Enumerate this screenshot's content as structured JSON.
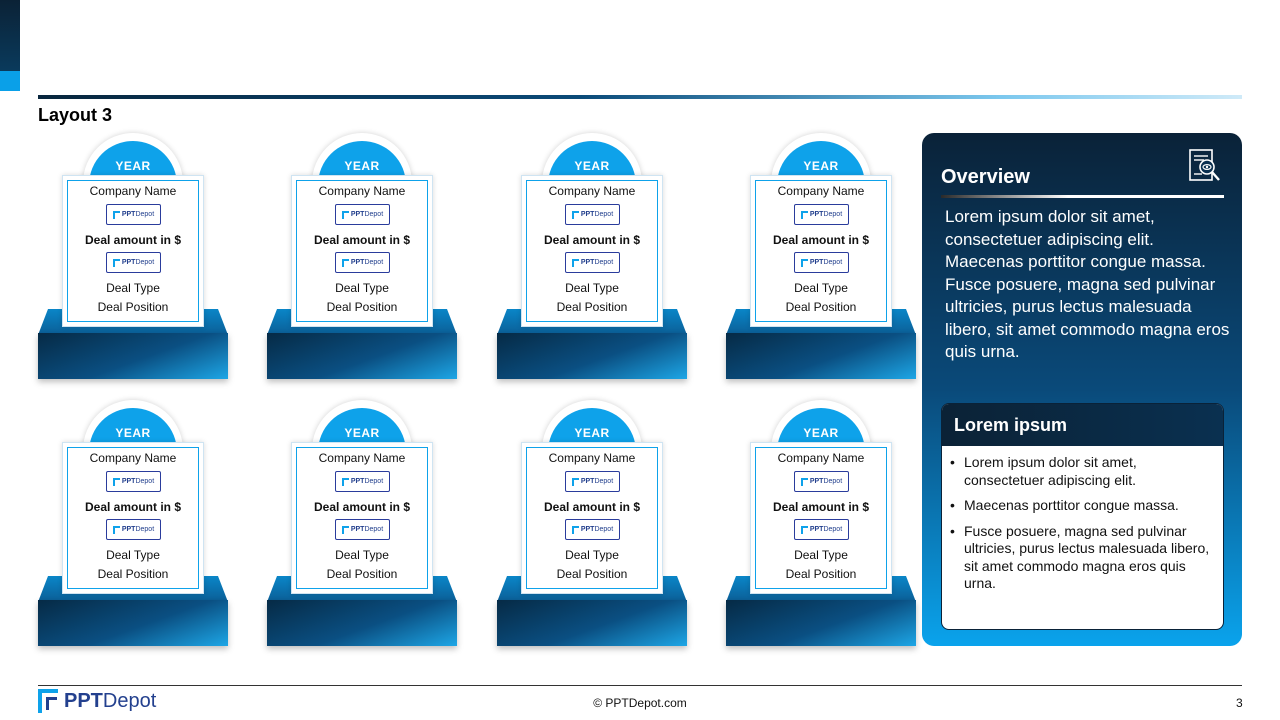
{
  "header": {
    "title": "Layout 3"
  },
  "cards": [
    {
      "year": "YEAR",
      "company": "Company Name",
      "amount": "Deal amount in $",
      "type": "Deal Type",
      "position": "Deal Position"
    },
    {
      "year": "YEAR",
      "company": "Company Name",
      "amount": "Deal amount in $",
      "type": "Deal Type",
      "position": "Deal Position"
    },
    {
      "year": "YEAR",
      "company": "Company Name",
      "amount": "Deal amount in $",
      "type": "Deal Type",
      "position": "Deal Position"
    },
    {
      "year": "YEAR",
      "company": "Company Name",
      "amount": "Deal amount in $",
      "type": "Deal Type",
      "position": "Deal Position"
    },
    {
      "year": "YEAR",
      "company": "Company Name",
      "amount": "Deal amount in $",
      "type": "Deal Type",
      "position": "Deal Position"
    },
    {
      "year": "YEAR",
      "company": "Company Name",
      "amount": "Deal amount in $",
      "type": "Deal Type",
      "position": "Deal Position"
    },
    {
      "year": "YEAR",
      "company": "Company Name",
      "amount": "Deal amount in $",
      "type": "Deal Type",
      "position": "Deal Position"
    },
    {
      "year": "YEAR",
      "company": "Company Name",
      "amount": "Deal amount in $",
      "type": "Deal Type",
      "position": "Deal Position"
    }
  ],
  "logo_badge": {
    "bold": "PPT",
    "rest": "Depot"
  },
  "overview": {
    "title": "Overview",
    "icon": "document-search-icon",
    "text": "Lorem ipsum dolor sit amet, consectetuer adipiscing elit. Maecenas porttitor congue massa. Fusce posuere, magna sed pulvinar ultricies, purus lectus malesuada libero, sit amet commodo magna eros quis urna.",
    "sub_title": "Lorem ipsum",
    "bullets": [
      "Lorem ipsum dolor sit amet, consectetuer adipiscing elit.",
      "Maecenas porttitor congue massa.",
      "Fusce posuere, magna sed pulvinar ultricies, purus lectus malesuada libero, sit amet commodo magna eros quis urna."
    ]
  },
  "footer": {
    "brand_bold": "PPT",
    "brand_rest": "Depot",
    "copyright": "© PPTDepot.com",
    "page": "3"
  },
  "colors": {
    "accent": "#0ea2ea",
    "dark": "#0b2236",
    "brand": "#23408e"
  }
}
